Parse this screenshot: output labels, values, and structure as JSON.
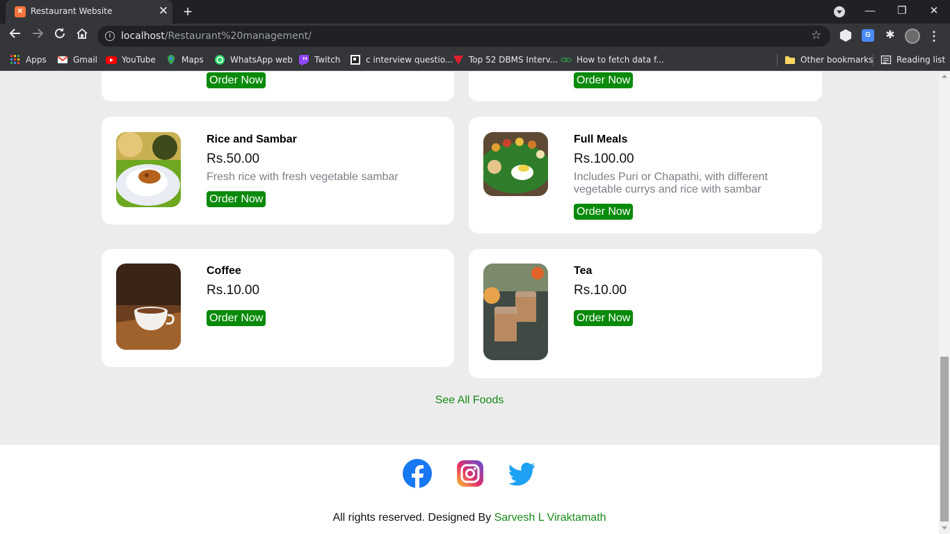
{
  "browser": {
    "tab_title": "Restaurant Website",
    "tab_close": "✕",
    "new_tab": "+",
    "url_host": "localhost",
    "url_path": "/Restaurant%20management/",
    "window_controls": {
      "minimize": "—",
      "restore": "❐",
      "close": "✕"
    },
    "bookmarks": [
      {
        "label": "Apps",
        "icon": "apps-grid-icon"
      },
      {
        "label": "Gmail",
        "icon": "gmail-icon"
      },
      {
        "label": "YouTube",
        "icon": "youtube-icon"
      },
      {
        "label": "Maps",
        "icon": "maps-icon"
      },
      {
        "label": "WhatsApp web",
        "icon": "whatsapp-icon"
      },
      {
        "label": "Twitch",
        "icon": "twitch-icon"
      },
      {
        "label": "c interview questio...",
        "icon": "page-icon"
      },
      {
        "label": "Top 52 DBMS Interv...",
        "icon": "guru-icon"
      },
      {
        "label": "How to fetch data f...",
        "icon": "link-icon"
      }
    ],
    "other_bookmarks": "Other bookmarks",
    "reading_list": "Reading list"
  },
  "menu": {
    "order_label": "Order Now",
    "items": [
      {
        "name": "Rice and Sambar",
        "price": "Rs.50.00",
        "description": "Fresh rice with fresh vegetable sambar",
        "image": "rice-sambar-image"
      },
      {
        "name": "Full Meals",
        "price": "Rs.100.00",
        "description": "Includes Puri or Chapathi, with different vegetable currys and rice with sambar",
        "image": "full-meals-image"
      },
      {
        "name": "Coffee",
        "price": "Rs.10.00",
        "description": "",
        "image": "coffee-image"
      },
      {
        "name": "Tea",
        "price": "Rs.10.00",
        "description": "",
        "image": "tea-image"
      }
    ],
    "see_all": "See All Foods"
  },
  "footer": {
    "social": [
      "facebook-icon",
      "instagram-icon",
      "twitter-icon"
    ],
    "copyright_prefix": "All rights reserved. Designed By ",
    "author": "Sarvesh L Viraktamath"
  },
  "colors": {
    "accent_green": "#0a8a0a",
    "link_green": "#178a17",
    "page_bg": "#ececec",
    "chrome_dark": "#202124"
  }
}
